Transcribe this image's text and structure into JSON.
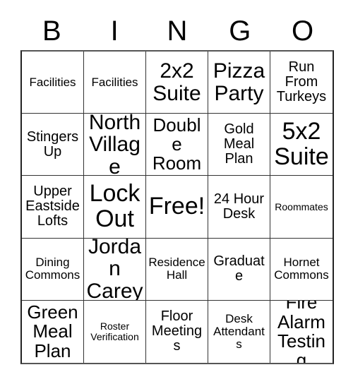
{
  "card": {
    "header_letters": [
      "B",
      "I",
      "N",
      "G",
      "O"
    ],
    "rows": [
      [
        {
          "text": "Facilities",
          "size": "sm"
        },
        {
          "text": "Facilities",
          "size": "sm"
        },
        {
          "text": "2x2 Suite",
          "size": "xl"
        },
        {
          "text": "Pizza Party",
          "size": "xl"
        },
        {
          "text": "Run From Turkeys",
          "size": "md"
        }
      ],
      [
        {
          "text": "Stingers Up",
          "size": "md"
        },
        {
          "text": "North Village",
          "size": "xl"
        },
        {
          "text": "Double Room",
          "size": "lg"
        },
        {
          "text": "Gold Meal Plan",
          "size": "md"
        },
        {
          "text": "5x2 Suite",
          "size": "xxl"
        }
      ],
      [
        {
          "text": "Upper Eastside Lofts",
          "size": "md"
        },
        {
          "text": "Lock Out",
          "size": "xxl"
        },
        {
          "text": "Free!",
          "size": "xxl"
        },
        {
          "text": "24 Hour Desk",
          "size": "md"
        },
        {
          "text": "Roommates",
          "size": "xs"
        }
      ],
      [
        {
          "text": "Dining Commons",
          "size": "sm"
        },
        {
          "text": "Jordan Carey",
          "size": "xl"
        },
        {
          "text": "Residence Hall",
          "size": "sm"
        },
        {
          "text": "Graduate",
          "size": "md"
        },
        {
          "text": "Hornet Commons",
          "size": "sm"
        }
      ],
      [
        {
          "text": "Green Meal Plan",
          "size": "lg"
        },
        {
          "text": "Roster Verification",
          "size": "xs"
        },
        {
          "text": "Floor Meetings",
          "size": "md"
        },
        {
          "text": "Desk Attendants",
          "size": "sm"
        },
        {
          "text": "Fire Alarm Testing",
          "size": "lg"
        }
      ]
    ]
  },
  "colors": {
    "background": "#ffffff",
    "text": "#000000",
    "grid_line": "#333333",
    "grid_outer": "#222222"
  }
}
